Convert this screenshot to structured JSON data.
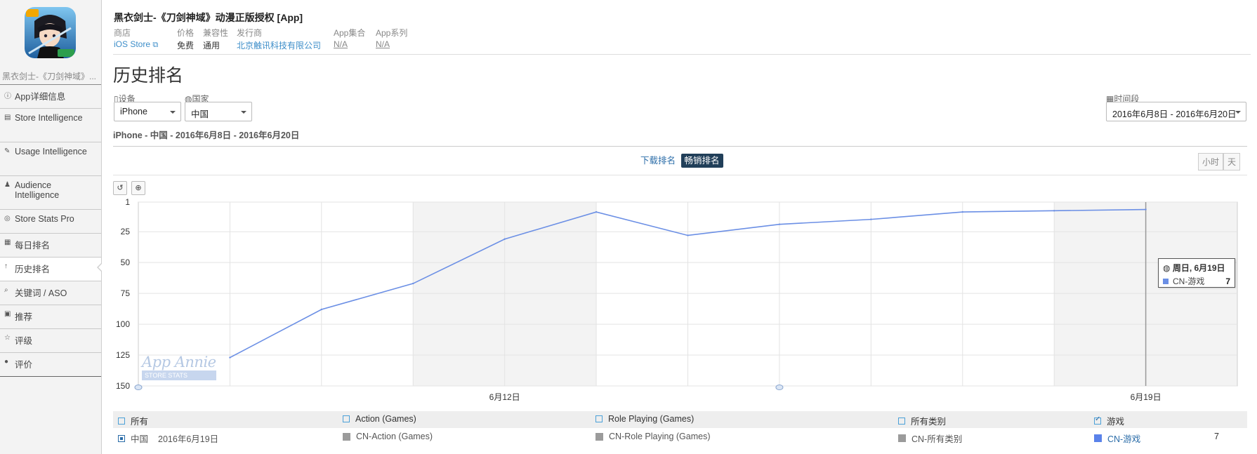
{
  "app": {
    "title": "黑衣剑士-《刀剑神域》动漫正版授权 [App]",
    "sidebar_name": "黑衣剑士-《刀剑神域》...",
    "meta": {
      "store_label": "商店",
      "store_value": "iOS Store",
      "price_label": "价格",
      "price_value": "免费",
      "compat_label": "兼容性",
      "compat_value": "通用",
      "publisher_label": "发行商",
      "publisher_value": "北京触讯科技有限公司",
      "collection_label": "App集合",
      "collection_value": "N/A",
      "series_label": "App系列",
      "series_value": "N/A"
    }
  },
  "sidebar": {
    "items": [
      {
        "icon": "info-icon",
        "label": "App详细信息"
      },
      {
        "icon": "store-icon",
        "label": "Store Intelligence"
      },
      {
        "icon": "usage-icon",
        "label": "Usage Intelligence"
      },
      {
        "icon": "person-icon",
        "label": "Audience Intelligence"
      },
      {
        "icon": "stats-icon",
        "label": "Store Stats Pro"
      },
      {
        "icon": "calendar-icon",
        "label": "每日排名"
      },
      {
        "icon": "arrow-up-icon",
        "label": "历史排名"
      },
      {
        "icon": "keyword-icon",
        "label": "关键词 / ASO"
      },
      {
        "icon": "bookmark-icon",
        "label": "推荐"
      },
      {
        "icon": "star-icon",
        "label": "评级"
      },
      {
        "icon": "comment-icon",
        "label": "评价"
      }
    ]
  },
  "page": {
    "title": "历史排名",
    "filters": {
      "device_label": "设备",
      "device_value": "iPhone",
      "country_label": "国家",
      "country_value": "中国",
      "period_label": "时间段",
      "period_value": "2016年6月8日 - 2016年6月20日"
    },
    "subtitle": "iPhone - 中国 - 2016年6月8日 - 2016年6月20日",
    "tabs": {
      "downloads": "下载排名",
      "grossing": "畅销排名"
    },
    "units": {
      "hour": "小时",
      "day": "天"
    }
  },
  "chart_data": {
    "type": "line",
    "y_reversed": true,
    "ylim": [
      1,
      150
    ],
    "yticks": [
      1,
      25,
      50,
      75,
      100,
      125,
      150
    ],
    "x": [
      "6月9日",
      "6月10日",
      "6月11日",
      "6月12日",
      "6月13日",
      "6月14日",
      "6月15日",
      "6月16日",
      "6月17日",
      "6月18日",
      "6月19日"
    ],
    "xtick_labels": [
      "6月12日",
      "6月19日"
    ],
    "series": [
      {
        "name": "CN-游戏",
        "color": "#6b8fe5",
        "values": [
          127,
          88,
          67,
          31,
          9,
          28,
          19,
          15,
          9,
          8,
          7
        ]
      }
    ]
  },
  "tooltip": {
    "title": "周日, 6月19日",
    "series": "CN-游戏",
    "value": "7"
  },
  "watermark": {
    "brand": "App Annie",
    "sub": "STORE STATS"
  },
  "legend": {
    "headers": [
      "所有",
      "Action (Games)",
      "Role Playing (Games)",
      "所有类别",
      "游戏"
    ],
    "row": {
      "country": "中国",
      "date": "2016年6月19日",
      "cols": [
        "CN-Action (Games)",
        "CN-Role Playing (Games)",
        "CN-所有类别",
        "CN-游戏"
      ],
      "value": "7"
    }
  }
}
